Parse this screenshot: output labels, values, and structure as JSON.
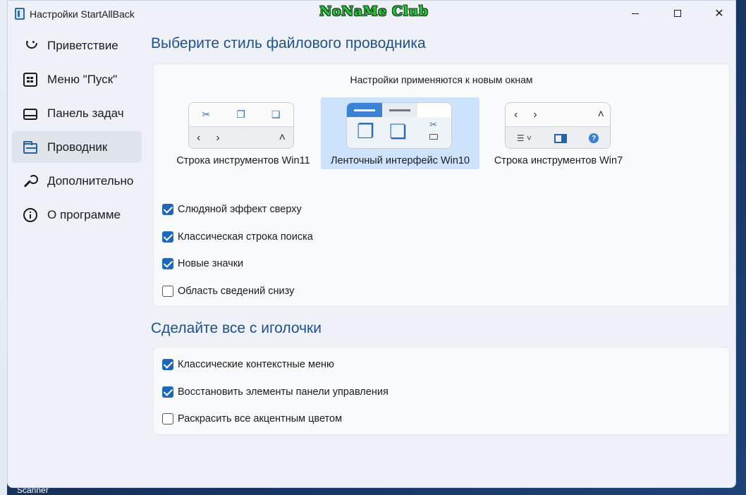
{
  "window": {
    "title": "Настройки StartAllBack",
    "watermark": "NoNaMe Club",
    "accent_color": "#1f67b8"
  },
  "desktop": {
    "icon_label": "Scanner"
  },
  "sidebar": {
    "items": [
      {
        "label": "Приветствие",
        "icon": "smile-icon",
        "active": false
      },
      {
        "label": "Меню \"Пуск\"",
        "icon": "start-menu-icon",
        "active": false
      },
      {
        "label": "Панель задач",
        "icon": "taskbar-icon",
        "active": false
      },
      {
        "label": "Проводник",
        "icon": "folder-icon",
        "active": true
      },
      {
        "label": "Дополнительно",
        "icon": "wrench-icon",
        "active": false
      },
      {
        "label": "О программе",
        "icon": "info-icon",
        "active": false
      }
    ]
  },
  "main": {
    "section1_title": "Выберите стиль файлового проводника",
    "note": "Настройки применяются к новым окнам",
    "styles": [
      {
        "label": "Строка инструментов Win11",
        "selected": false
      },
      {
        "label": "Ленточный интерфейс Win10",
        "selected": true
      },
      {
        "label": "Строка инструментов Win7",
        "selected": false
      }
    ],
    "explorer_options": [
      {
        "label": "Слюдяной эффект сверху",
        "checked": true
      },
      {
        "label": "Классическая строка поиска",
        "checked": true
      },
      {
        "label": "Новые значки",
        "checked": true
      },
      {
        "label": "Область сведений снизу",
        "checked": false
      }
    ],
    "section2_title": "Сделайте все с иголочки",
    "tweak_options": [
      {
        "label": "Классические контекстные меню",
        "checked": true
      },
      {
        "label": "Восстановить элементы панели управления",
        "checked": true
      },
      {
        "label": "Раскрасить все акцентным цветом",
        "checked": false
      }
    ]
  }
}
